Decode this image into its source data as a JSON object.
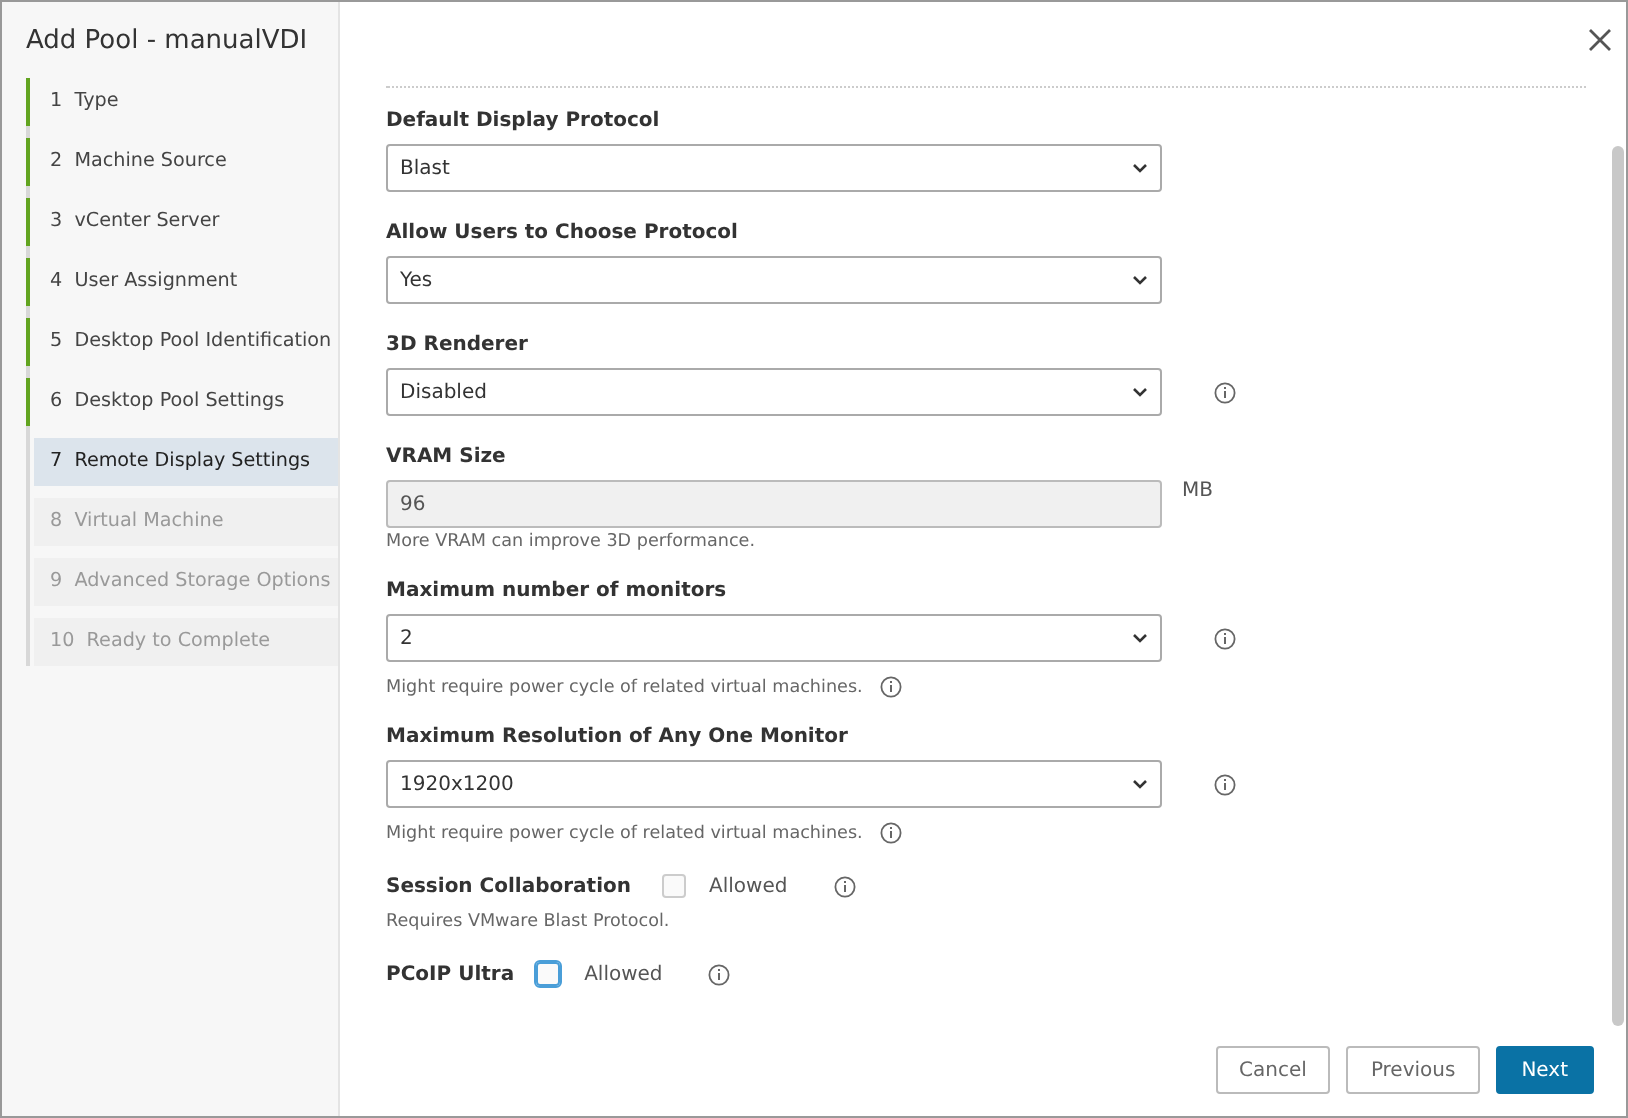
{
  "dialog": {
    "title": "Add Pool - manualVDI"
  },
  "steps": [
    {
      "number": "1",
      "label": "Type",
      "completed": true,
      "selected": false
    },
    {
      "number": "2",
      "label": "Machine Source",
      "completed": true,
      "selected": false
    },
    {
      "number": "3",
      "label": "vCenter Server",
      "completed": true,
      "selected": false
    },
    {
      "number": "4",
      "label": "User Assignment",
      "completed": true,
      "selected": false
    },
    {
      "number": "5",
      "label": "Desktop Pool Identification",
      "completed": true,
      "selected": false
    },
    {
      "number": "6",
      "label": "Desktop Pool Settings",
      "completed": true,
      "selected": false
    },
    {
      "number": "7",
      "label": "Remote Display Settings",
      "completed": false,
      "selected": true
    },
    {
      "number": "8",
      "label": "Virtual Machine",
      "completed": false,
      "selected": false
    },
    {
      "number": "9",
      "label": "Advanced Storage Options",
      "completed": false,
      "selected": false
    },
    {
      "number": "10",
      "label": "Ready to Complete",
      "completed": false,
      "selected": false
    }
  ],
  "fields": [
    {
      "kind": "select",
      "label": "Default Display Protocol",
      "value": "Blast",
      "info": false
    },
    {
      "kind": "select",
      "label": "Allow Users to Choose Protocol",
      "value": "Yes",
      "info": false
    },
    {
      "kind": "select",
      "label": "3D Renderer",
      "value": "Disabled",
      "info": true
    },
    {
      "kind": "input",
      "label": "VRAM Size",
      "value": "96",
      "disabled": true,
      "unit": "MB",
      "info": false,
      "hint": "More VRAM can improve 3D performance.",
      "hint_info": false
    },
    {
      "kind": "select",
      "label": "Maximum number of monitors",
      "value": "2",
      "info": true,
      "hint": "Might require power cycle of related virtual machines.",
      "hint_info": true
    },
    {
      "kind": "select",
      "label": "Maximum Resolution of Any One Monitor",
      "value": "1920x1200",
      "info": true,
      "hint": "Might require power cycle of related virtual machines.",
      "hint_info": true
    },
    {
      "kind": "checkbox",
      "label": "Session Collaboration",
      "option": "Allowed",
      "checked": false,
      "focused": false,
      "info": true,
      "hint": "Requires VMware Blast Protocol.",
      "hint_info": false
    },
    {
      "kind": "checkbox",
      "label": "PCoIP Ultra",
      "option": "Allowed",
      "checked": false,
      "focused": true,
      "info": true
    }
  ],
  "buttons": [
    {
      "label": "Cancel",
      "primary": false
    },
    {
      "label": "Previous",
      "primary": false
    },
    {
      "label": "Next",
      "primary": true
    }
  ]
}
